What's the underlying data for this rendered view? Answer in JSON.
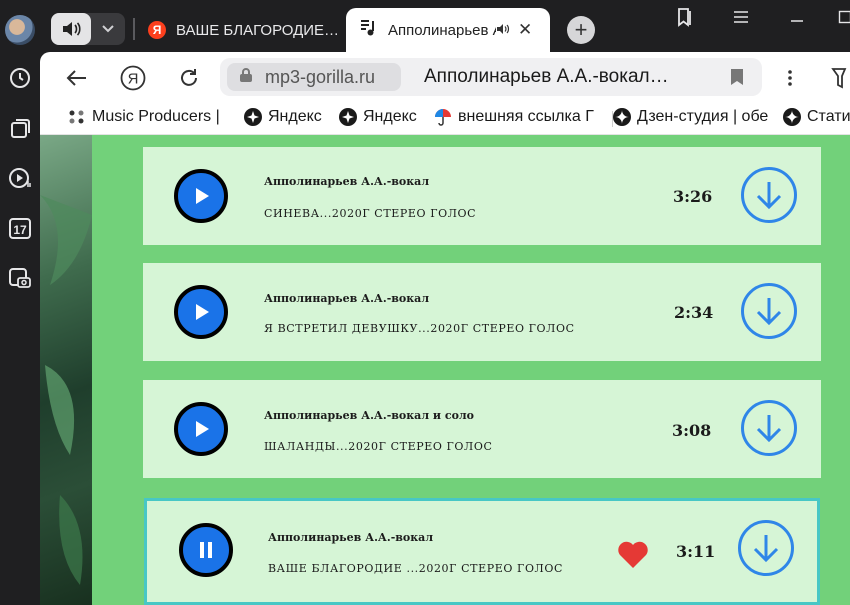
{
  "tabs": {
    "tab1_title": "ВАШЕ БЛАГОРОДИЕ…",
    "tab1_favicon": "Я",
    "tab2_title": "Апполинарьев А.А.-вокал",
    "close_glyph": "✕",
    "new_tab_glyph": "+"
  },
  "toolbar": {
    "yandex_glyph": "Я",
    "domain": "mp3-gorilla.ru",
    "page_title": "Апполинарьев А.А.-вокал…"
  },
  "bookmarks": [
    {
      "label": "Music Producers |",
      "icon": "dots-icon"
    },
    {
      "label": "Яндекс",
      "icon": "yandex-star-icon"
    },
    {
      "label": "Яндекс",
      "icon": "yandex-star-icon"
    },
    {
      "label": "внешняя ссылка Г",
      "icon": "umbrella-icon"
    },
    {
      "label": "Дзен-студия | обе",
      "icon": "zen-icon"
    },
    {
      "label": "Стати",
      "icon": "zen-icon"
    }
  ],
  "sidebar": {
    "calendar_day": "17"
  },
  "tracks": [
    {
      "artist": "Апполинарьев А.А.-вокал",
      "title": "СИНЕВА...2020Г СТЕРЕО ГОЛОС",
      "duration": "3:26",
      "state": "play"
    },
    {
      "artist": "Апполинарьев А.А.-вокал",
      "title": "Я ВСТРЕТИЛ ДЕВУШКУ...2020Г СТЕРЕО ГОЛОС",
      "duration": "2:34",
      "state": "play"
    },
    {
      "artist": "Апполинарьев А.А.-вокал и соло",
      "title": "ШАЛАНДЫ...2020Г СТЕРЕО ГОЛОС",
      "duration": "3:08",
      "state": "play"
    },
    {
      "artist": "Апполинарьев А.А.-вокал",
      "title": "ВАШЕ БЛАГОРОДИЕ ...2020Г СТЕРЕО ГОЛОС",
      "duration": "3:11",
      "state": "pause"
    }
  ],
  "colors": {
    "page_bg": "#72d17a",
    "card_bg": "#d6f5d6",
    "accent_blue": "#1a73e8",
    "active_border": "#47c7c5",
    "heart": "#e53935"
  }
}
